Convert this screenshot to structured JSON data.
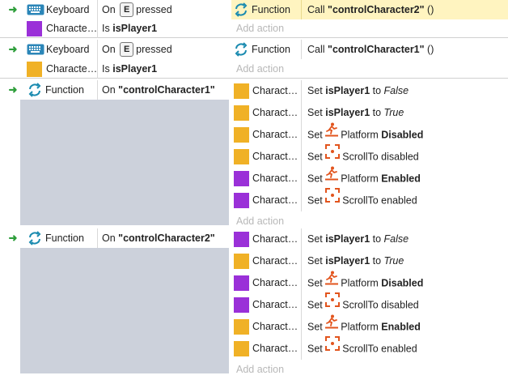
{
  "colors": {
    "object_purple": "#9a30d8",
    "object_yellow": "#f0b126",
    "function_blue": "#1b8bb0",
    "platform_orange": "#e2541d",
    "arrow_green": "#2e9e3b",
    "selected_row": "#fff4c0",
    "group_grey": "#ccd1db"
  },
  "events": [
    {
      "conditions": [
        {
          "icon": "keyboard-icon",
          "object": "Keyboard",
          "text_prefix": "On",
          "key": "E",
          "text_suffix": "pressed"
        },
        {
          "icon": "purple-square",
          "object": "Characte…",
          "text_prefix": "Is",
          "bold": "isPlayer1"
        }
      ],
      "actions": [
        {
          "icon": "function-icon",
          "object": "Function",
          "text_prefix": "Call",
          "bold": "\"controlCharacter2\"",
          "suffix": "()"
        }
      ],
      "add_action": "Add action"
    },
    {
      "conditions": [
        {
          "icon": "keyboard-icon",
          "object": "Keyboard",
          "text_prefix": "On",
          "key": "E",
          "text_suffix": "pressed"
        },
        {
          "icon": "yellow-square",
          "object": "Characte…",
          "text_prefix": "Is",
          "bold": "isPlayer1"
        }
      ],
      "actions": [
        {
          "icon": "function-icon",
          "object": "Function",
          "text_prefix": "Call",
          "bold": "\"controlCharacter1\"",
          "suffix": "()"
        }
      ],
      "add_action": "Add action"
    },
    {
      "conditions": [
        {
          "icon": "function-icon",
          "object": "Function",
          "text_prefix": "On",
          "bold": "\"controlCharacter1\""
        }
      ],
      "actions": [
        {
          "color": "yellow",
          "object": "Charact…",
          "text_prefix": "Set",
          "bold": "isPlayer1",
          "mid": "to",
          "italic": "False"
        },
        {
          "color": "yellow",
          "object": "Charact…",
          "text_prefix": "Set",
          "bold": "isPlayer1",
          "mid": "to",
          "italic": "True"
        },
        {
          "color": "yellow",
          "object": "Charact…",
          "text_prefix": "Set",
          "icon": "platform-icon",
          "plain": "Platform",
          "bold2": "Disabled"
        },
        {
          "color": "yellow",
          "object": "Charact…",
          "text_prefix": "Set",
          "icon": "scrollto-icon",
          "plain": "ScrollTo disabled"
        },
        {
          "color": "purple",
          "object": "Charact…",
          "text_prefix": "Set",
          "icon": "platform-icon",
          "plain": "Platform",
          "bold2": "Enabled"
        },
        {
          "color": "purple",
          "object": "Charact…",
          "text_prefix": "Set",
          "icon": "scrollto-icon",
          "plain": "ScrollTo enabled"
        }
      ],
      "add_action": "Add action"
    },
    {
      "conditions": [
        {
          "icon": "function-icon",
          "object": "Function",
          "text_prefix": "On",
          "bold": "\"controlCharacter2\""
        }
      ],
      "actions": [
        {
          "color": "purple",
          "object": "Charact…",
          "text_prefix": "Set",
          "bold": "isPlayer1",
          "mid": "to",
          "italic": "False"
        },
        {
          "color": "yellow",
          "object": "Charact…",
          "text_prefix": "Set",
          "bold": "isPlayer1",
          "mid": "to",
          "italic": "True"
        },
        {
          "color": "purple",
          "object": "Charact…",
          "text_prefix": "Set",
          "icon": "platform-icon",
          "plain": "Platform",
          "bold2": "Disabled"
        },
        {
          "color": "purple",
          "object": "Charact…",
          "text_prefix": "Set",
          "icon": "scrollto-icon",
          "plain": "ScrollTo disabled"
        },
        {
          "color": "yellow",
          "object": "Charact…",
          "text_prefix": "Set",
          "icon": "platform-icon",
          "plain": "Platform",
          "bold2": "Enabled"
        },
        {
          "color": "yellow",
          "object": "Charact…",
          "text_prefix": "Set",
          "icon": "scrollto-icon",
          "plain": "ScrollTo enabled"
        }
      ],
      "add_action": "Add action"
    }
  ]
}
